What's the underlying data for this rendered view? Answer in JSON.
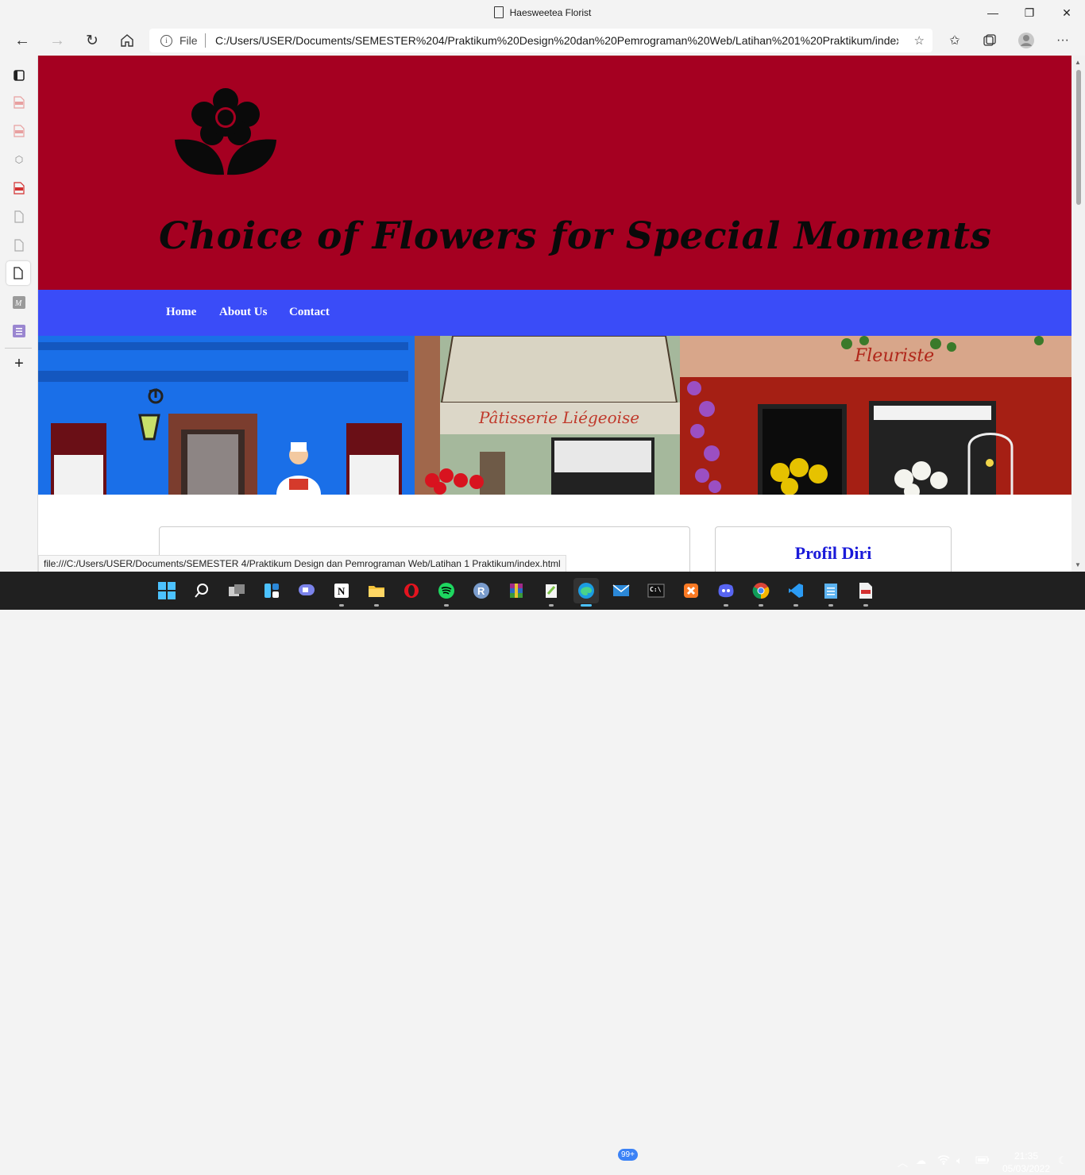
{
  "window": {
    "title": "Haesweetea Florist"
  },
  "address_bar": {
    "scheme_label": "File",
    "url": "C:/Users/USER/Documents/SEMESTER%204/Praktikum%20Design%20dan%20Pemrograman%20Web/Latihan%201%20Praktikum/index.h..."
  },
  "page": {
    "tagline": "Choice of Flowers for Special Moments",
    "nav": [
      "Home",
      "About Us",
      "Contact"
    ],
    "hero": {
      "sign_patisserie": "Pâtisserie Liégeoise",
      "sign_fleuriste": "Fleuriste"
    },
    "profile_heading": "Profil Diri"
  },
  "status_url": "file:///C:/Users/USER/Documents/SEMESTER 4/Praktikum Design dan Pemrograman Web/Latihan 1 Praktikum/index.html",
  "taskbar": {
    "mail_badge": "99+",
    "time": "21:35",
    "date": "05/03/2022"
  },
  "colors": {
    "header_bg": "#a50021",
    "nav_bg": "#3a4cf8",
    "profile_heading": "#1a1ad9"
  }
}
